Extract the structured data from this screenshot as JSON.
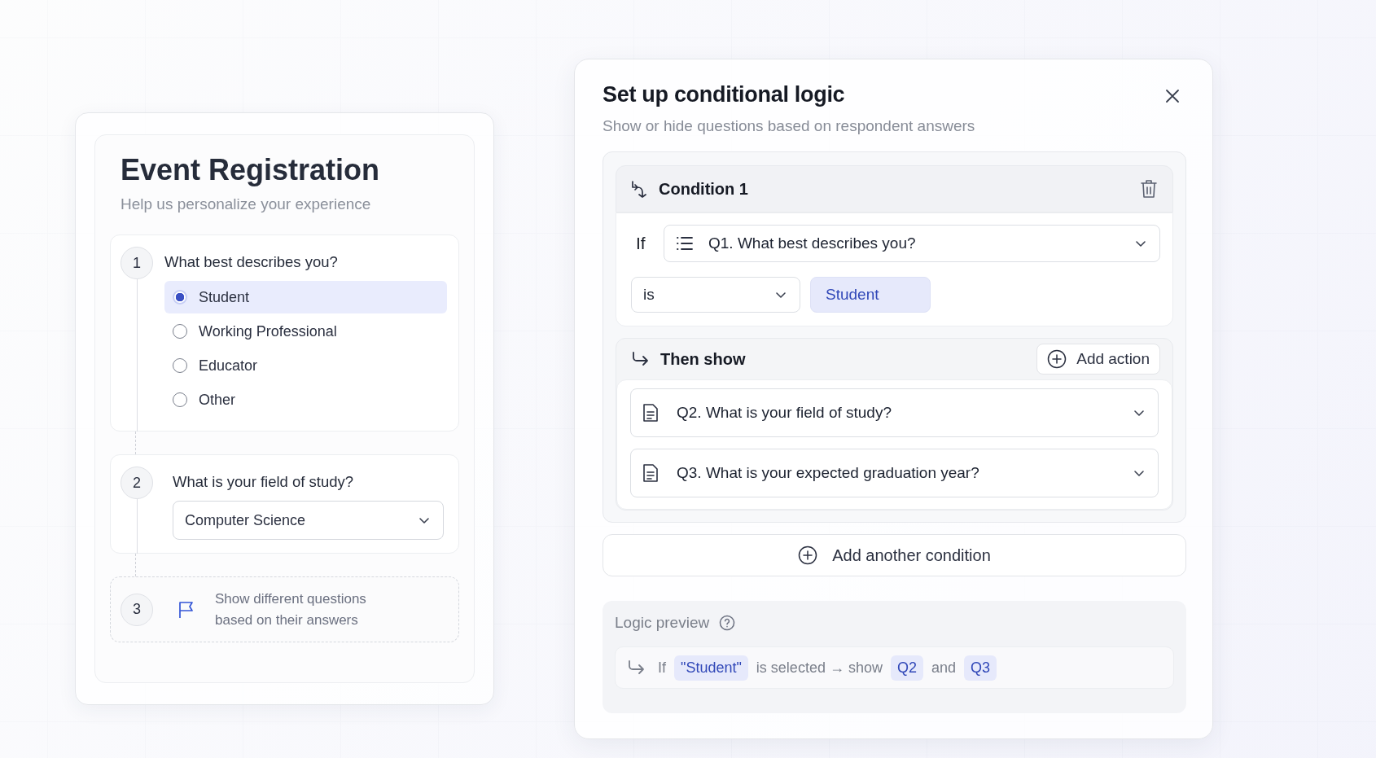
{
  "registration": {
    "title": "Event Registration",
    "subtitle": "Help us personalize your experience",
    "questions": [
      {
        "number": "1",
        "kind": "choice",
        "text": "What best describes you?",
        "options": [
          {
            "label": "Student",
            "selected": true
          },
          {
            "label": "Working Professional",
            "selected": false
          },
          {
            "label": "Educator",
            "selected": false
          },
          {
            "label": "Other",
            "selected": false
          }
        ]
      },
      {
        "number": "2",
        "kind": "dropdown",
        "text": "What is your field of study?",
        "value": "Computer Science"
      },
      {
        "number": "3",
        "kind": "hint",
        "text": "Show different questions based on their answers"
      }
    ]
  },
  "dialog": {
    "title": "Set up conditional logic",
    "subtitle": "Show or hide questions based on respondent answers",
    "condition": {
      "title": "Condition 1",
      "if_label": "If",
      "question": "Q1. What best describes you?",
      "operator": "is",
      "value": "Student",
      "then_label": "Then show",
      "add_action": "Add action",
      "actions": [
        "Q2. What is your field of study?",
        "Q3. What is your expected graduation year?"
      ]
    },
    "add_condition": "Add another condition",
    "preview": {
      "title": "Logic preview",
      "parts": [
        {
          "kind": "text",
          "text": "If"
        },
        {
          "kind": "chip",
          "text": "\"Student\""
        },
        {
          "kind": "text",
          "text": "is selected → show"
        },
        {
          "kind": "chip",
          "text": "Q2"
        },
        {
          "kind": "text",
          "text": "and"
        },
        {
          "kind": "chip",
          "text": "Q3"
        }
      ]
    }
  }
}
